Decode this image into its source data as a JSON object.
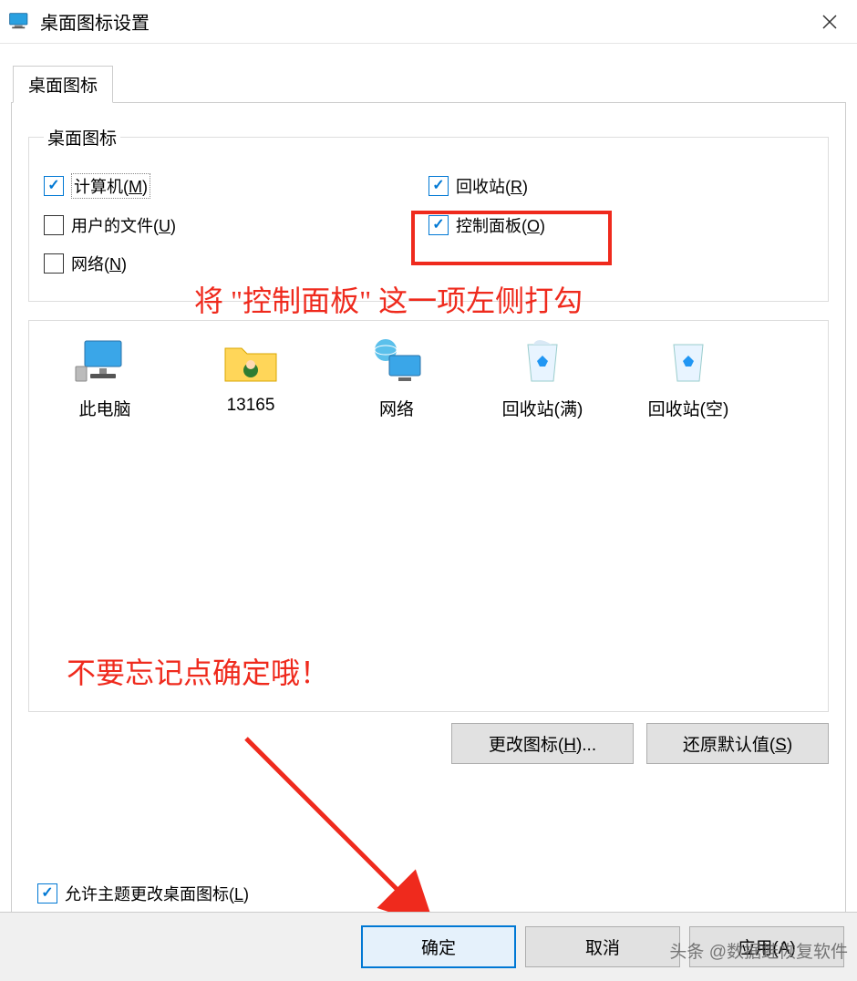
{
  "window": {
    "title": "桌面图标设置"
  },
  "tab": {
    "label": "桌面图标"
  },
  "group": {
    "legend": "桌面图标"
  },
  "checks": {
    "computer": {
      "label_pre": "计算机(",
      "key": "M",
      "label_post": ")"
    },
    "recycle": {
      "label_pre": "回收站(",
      "key": "R",
      "label_post": ")"
    },
    "userfiles": {
      "label_pre": "用户的文件(",
      "key": "U",
      "label_post": ")"
    },
    "control": {
      "label_pre": "控制面板(",
      "key": "O",
      "label_post": ")"
    },
    "network": {
      "label_pre": "网络(",
      "key": "N",
      "label_post": ")"
    }
  },
  "annotations": {
    "check_hint": "将 \"控制面板\" 这一项左侧打勾",
    "ok_hint": "不要忘记点确定哦！"
  },
  "icons": {
    "thispc": "此电脑",
    "user": "13165",
    "network": "网络",
    "recycle_full": "回收站(满)",
    "recycle_empty": "回收站(空)"
  },
  "buttons": {
    "change_icon_pre": "更改图标(",
    "change_icon_key": "H",
    "change_icon_post": ")...",
    "restore_pre": "还原默认值(",
    "restore_key": "S",
    "restore_post": ")"
  },
  "allow": {
    "pre": "允许主题更改桌面图标(",
    "key": "L",
    "post": ")"
  },
  "footer": {
    "ok": "确定",
    "cancel": "取消",
    "apply": "应用(A)"
  },
  "watermark": "头条 @数据蛙恢复软件"
}
